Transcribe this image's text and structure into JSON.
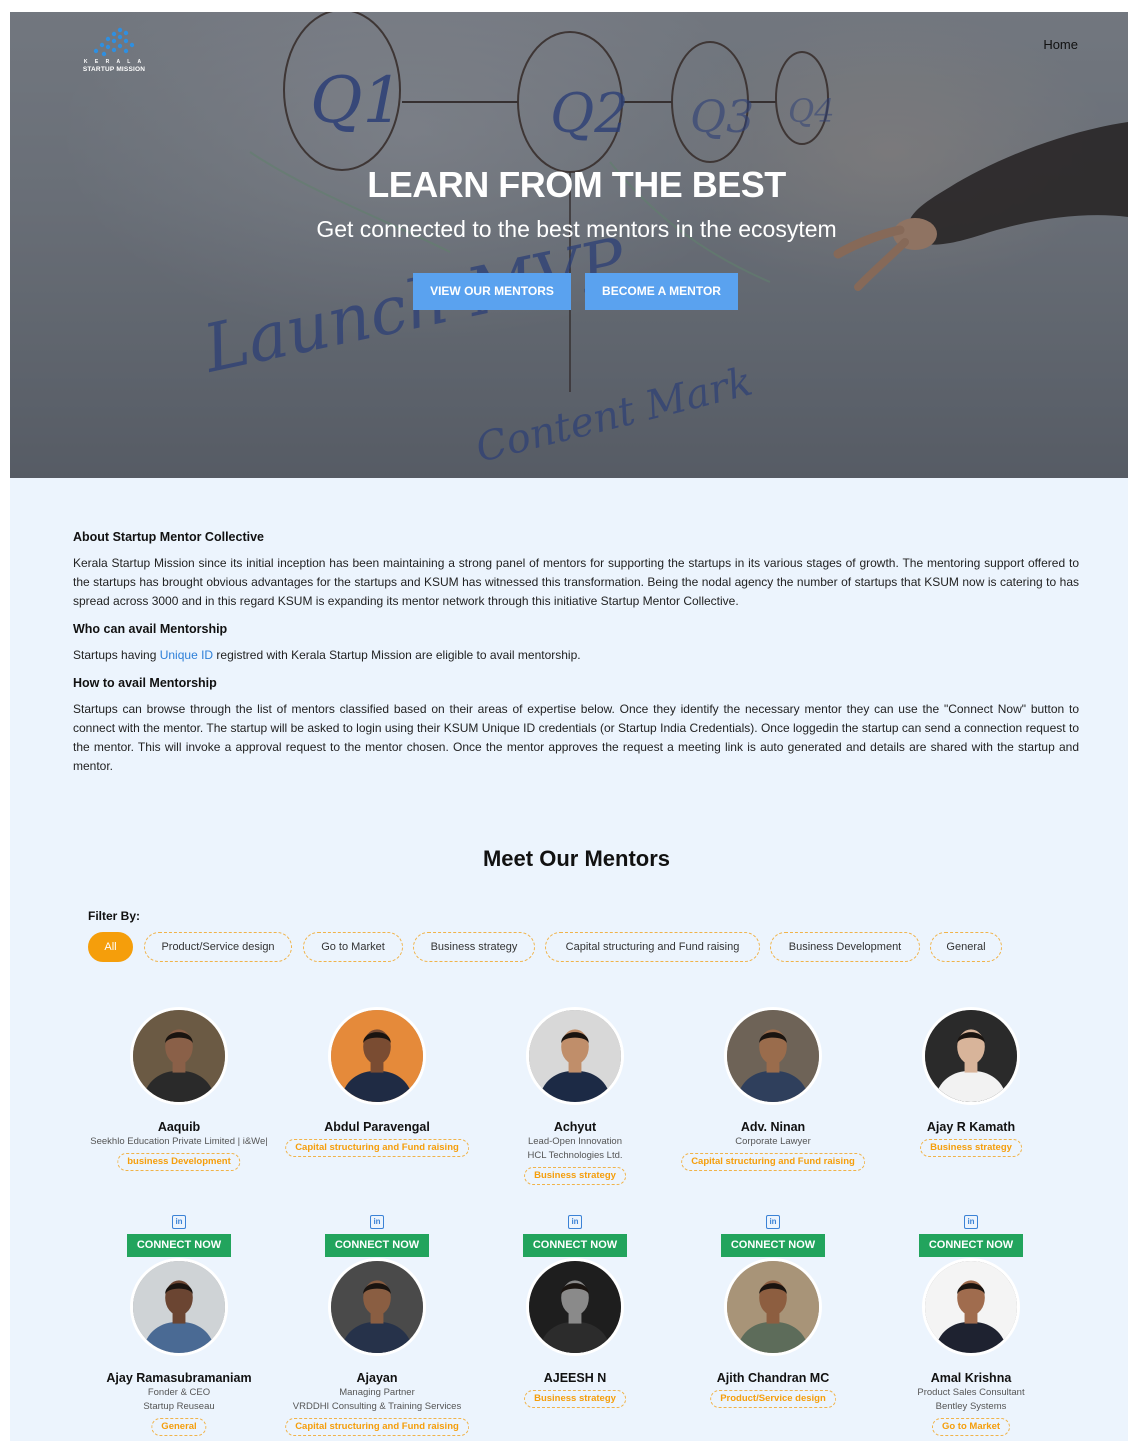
{
  "header": {
    "logo_top": "K E R A L A",
    "logo_name": "STARTUP MISSION",
    "nav_home": "Home"
  },
  "hero": {
    "title": "LEARN FROM THE BEST",
    "subtitle": "Get connected to the best mentors in the ecosytem",
    "btn_view": "VIEW OUR MENTORS",
    "btn_become": "BECOME A MENTOR",
    "board_marks": [
      "Q1",
      "Q2",
      "Q3",
      "Q4",
      "Launch MVP",
      "Content Mark"
    ]
  },
  "about": {
    "h1": "About Startup Mentor Collective",
    "p1": "Kerala Startup Mission since its initial inception has been maintaining a strong panel of mentors for supporting the startups in its various stages of growth. The mentoring support offered to the startups has brought obvious advantages for the startups and KSUM has witnessed this transformation. Being the nodal agency the number of startups that KSUM now is catering to has spread across 3000 and in this regard KSUM is expanding its mentor network through this initiative Startup Mentor Collective.",
    "h2": "Who can avail Mentorship",
    "p2_pre": "Startups having ",
    "p2_link": "Unique ID",
    "p2_post": " registred with Kerala Startup Mission are eligible to avail mentorship.",
    "h3": "How to avail Mentorship",
    "p3": "Startups can browse through the list of mentors classified based on their areas of expertise below. Once they identify the necessary mentor they can use the \"Connect Now\" button to connect with the mentor. The startup will be asked to login using their KSUM Unique ID credentials (or Startup India Credentials). Once loggedin the startup can send a connection request to the mentor. This will invoke a approval request to the mentor chosen. Once the mentor approves the request a meeting link is auto generated and details are shared with the startup and mentor."
  },
  "mentors_section": {
    "title": "Meet Our Mentors",
    "filter_label": "Filter By:",
    "filters": [
      "All",
      "Product/Service design",
      "Go to Market",
      "Business strategy",
      "Capital structuring and Fund raising",
      "Business Development",
      "General"
    ],
    "linkedin_glyph": "in",
    "connect_label": "CONNECT NOW"
  },
  "mentors": [
    {
      "name": "Aaquib",
      "lines": [
        "Seekhlo Education Private Limited | i&We|"
      ],
      "tag": "business Development",
      "bg": "#6b5a44",
      "skin": "#8a6048",
      "shirt": "#2a2a2a"
    },
    {
      "name": "Abdul Paravengal",
      "lines": [],
      "tag": "Capital structuring and Fund raising",
      "bg": "#e58a3a",
      "skin": "#7a4c32",
      "shirt": "#1f2b44"
    },
    {
      "name": "Achyut",
      "lines": [
        "Lead-Open Innovation",
        "HCL Technologies Ltd."
      ],
      "tag": "Business strategy",
      "bg": "#d8d8d8",
      "skin": "#c08e6a",
      "shirt": "#1c2a45"
    },
    {
      "name": "Adv. Ninan",
      "lines": [
        "Corporate Lawyer"
      ],
      "tag": "Capital structuring and Fund raising",
      "bg": "#6e6357",
      "skin": "#9a6c4c",
      "shirt": "#2f3f5c"
    },
    {
      "name": "Ajay R Kamath",
      "lines": [],
      "tag": "Business strategy",
      "bg": "#2a2a2a",
      "skin": "#d8b49a",
      "shirt": "#f2f2f2"
    },
    {
      "name": "Ajay Ramasubramaniam",
      "lines": [
        "Fonder & CEO",
        "Startup Reuseau"
      ],
      "tag": "General",
      "bg": "#cfd3d6",
      "skin": "#6b4532",
      "shirt": "#4a6a94"
    },
    {
      "name": "Ajayan",
      "lines": [
        "Managing Partner",
        "VRDDHI Consulting & Training Services"
      ],
      "tag": "Capital structuring and Fund raising",
      "bg": "#4a4a4a",
      "skin": "#8a5e42",
      "shirt": "#26324a"
    },
    {
      "name": "AJEESH N",
      "lines": [],
      "tag": "Business strategy",
      "bg": "#1e1e1e",
      "skin": "#8a8a8a",
      "shirt": "#2c2c2c"
    },
    {
      "name": "Ajith Chandran MC",
      "lines": [],
      "tag": "Product/Service design",
      "bg": "#a89478",
      "skin": "#8d5e40",
      "shirt": "#5d6c5a"
    },
    {
      "name": "Amal Krishna",
      "lines": [
        "Product Sales Consultant",
        "Bentley Systems"
      ],
      "tag": "Go to Market",
      "bg": "#f4f4f4",
      "skin": "#a06c4e",
      "shirt": "#1e2230"
    }
  ]
}
